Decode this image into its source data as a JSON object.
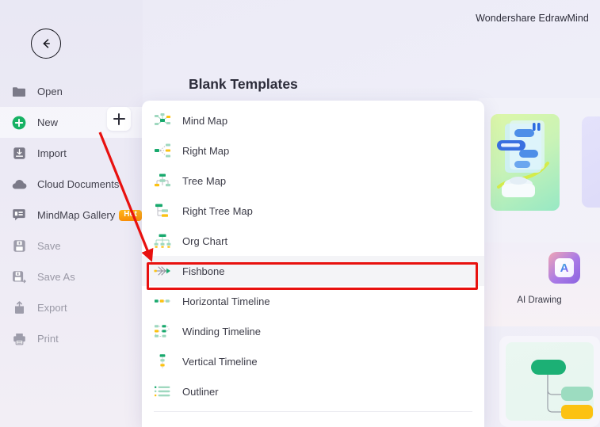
{
  "app": {
    "title": "Wondershare EdrawMind"
  },
  "sidebar": {
    "back_icon": "back-arrow-icon",
    "add_button_icon": "plus-icon",
    "items": [
      {
        "label": "Open",
        "icon": "folder-icon",
        "state": "normal"
      },
      {
        "label": "New",
        "icon": "plus-circle-icon",
        "state": "active"
      },
      {
        "label": "Import",
        "icon": "import-icon",
        "state": "normal"
      },
      {
        "label": "Cloud Documents",
        "icon": "cloud-icon",
        "state": "normal"
      },
      {
        "label": "MindMap Gallery",
        "icon": "gallery-icon",
        "state": "normal",
        "badge": "Hot"
      },
      {
        "label": "Save",
        "icon": "save-icon",
        "state": "disabled"
      },
      {
        "label": "Save As",
        "icon": "save-as-icon",
        "state": "disabled"
      },
      {
        "label": "Export",
        "icon": "export-icon",
        "state": "disabled"
      },
      {
        "label": "Print",
        "icon": "print-icon",
        "state": "disabled"
      }
    ]
  },
  "main": {
    "page_title": "Blank Templates"
  },
  "dropdown": {
    "items": [
      {
        "label": "Mind Map",
        "icon": "mind-map-icon"
      },
      {
        "label": "Right Map",
        "icon": "right-map-icon"
      },
      {
        "label": "Tree Map",
        "icon": "tree-map-icon"
      },
      {
        "label": "Right Tree Map",
        "icon": "right-tree-map-icon"
      },
      {
        "label": "Org Chart",
        "icon": "org-chart-icon"
      },
      {
        "label": "Fishbone",
        "icon": "fishbone-icon",
        "selected": true,
        "highlighted": true
      },
      {
        "label": "Horizontal Timeline",
        "icon": "horizontal-timeline-icon"
      },
      {
        "label": "Winding Timeline",
        "icon": "winding-timeline-icon"
      },
      {
        "label": "Vertical Timeline",
        "icon": "vertical-timeline-icon"
      },
      {
        "label": "Outliner",
        "icon": "outliner-icon"
      }
    ]
  },
  "promo": {
    "ai_drawing_label": "AI Drawing",
    "ai_drawing_icon": "ai-drawing-icon",
    "card_green_icon": "mind-map-illustration",
    "card_purple_icon": "purple-placeholder-card",
    "card_bottom_icon": "tree-preview-card"
  },
  "annotations": {
    "highlight_color": "#e8110f",
    "box_target": "Fishbone",
    "arrow_from": "New",
    "arrow_to": "Fishbone"
  },
  "colors": {
    "background": "#eeeef7",
    "accent_green": "#19b36b",
    "accent_yellow": "#fdc117",
    "accent_mint": "#9bdcc0",
    "annotation_red": "#e8110f",
    "hot_badge": "#f99a0a"
  }
}
